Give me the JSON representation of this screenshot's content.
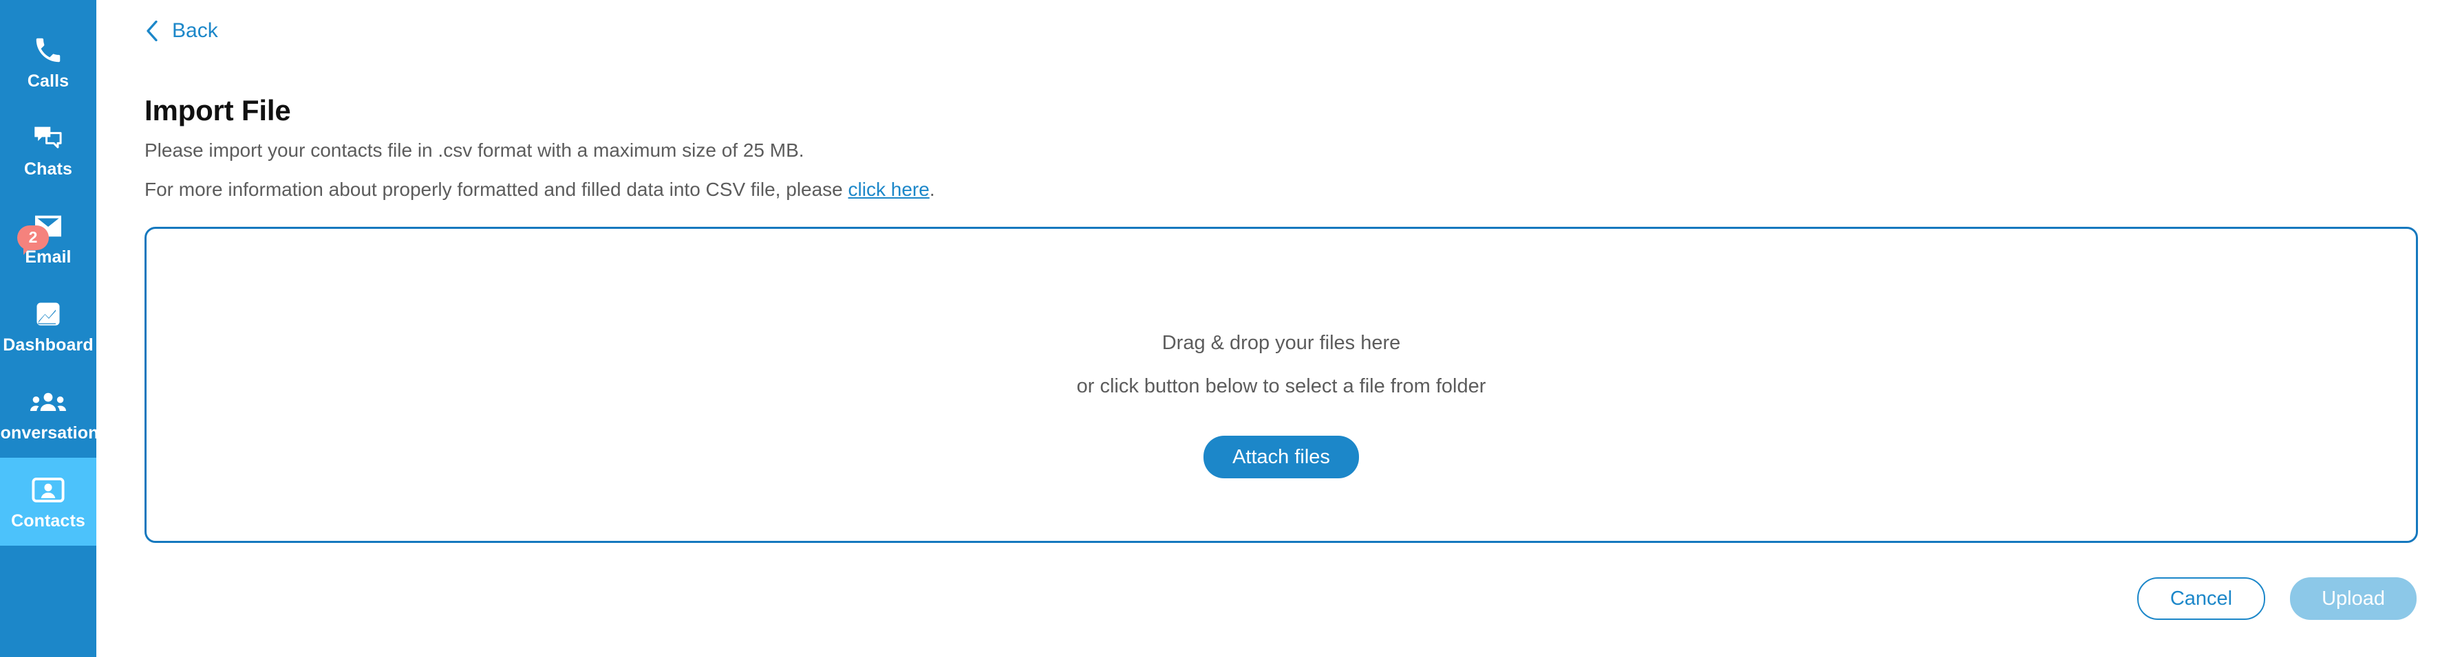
{
  "sidebar": {
    "background_color": "#1C87C9",
    "active_background_color": "#4CC2FB",
    "badge_color": "#F5827D",
    "items": [
      {
        "label": "Calls",
        "icon": "phone-icon",
        "active": false,
        "badge": null
      },
      {
        "label": "Chats",
        "icon": "chat-bubbles-icon",
        "active": false,
        "badge": null
      },
      {
        "label": "Email",
        "icon": "envelope-icon",
        "active": false,
        "badge": "2"
      },
      {
        "label": "Dashboard",
        "icon": "image-chart-icon",
        "active": false,
        "badge": null
      },
      {
        "label": "Conversations",
        "icon": "people-group-icon",
        "active": false,
        "badge": null
      },
      {
        "label": "Contacts",
        "icon": "contact-card-icon",
        "active": true,
        "badge": null
      }
    ]
  },
  "header": {
    "back_label": "Back",
    "back_icon": "chevron-left-icon"
  },
  "page": {
    "title": "Import File",
    "description_line_1": "Please import your contacts file in .csv format with a maximum size of 25 MB.",
    "description_line_2_prefix": "For more information about properly formatted and filled data into CSV file, please ",
    "description_line_2_link": "click here",
    "description_line_2_suffix": "."
  },
  "dropzone": {
    "line_1": "Drag & drop your files here",
    "line_2": "or click button below to select a file from folder",
    "attach_button_label": "Attach files",
    "border_color": "#1578BE",
    "accent_color": "#1C87C9"
  },
  "actions": {
    "cancel_label": "Cancel",
    "upload_label": "Upload",
    "upload_disabled_color": "#8CC8E8"
  }
}
